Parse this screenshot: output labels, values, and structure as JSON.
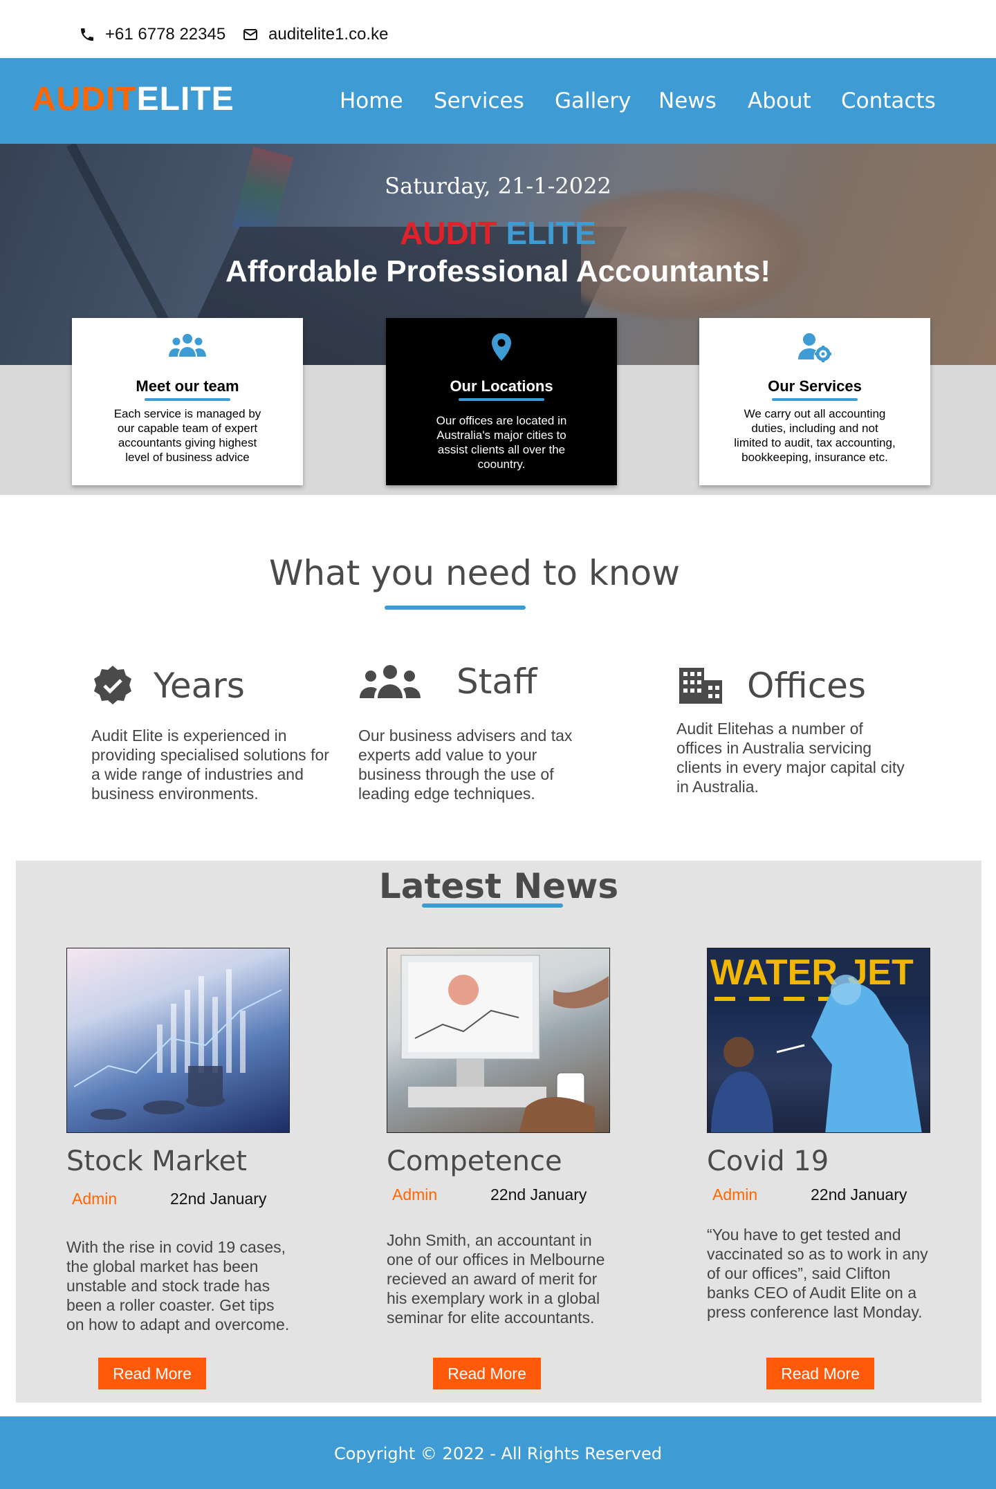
{
  "contact": {
    "phone": "+61 6778 22345",
    "email": "auditelite1.co.ke"
  },
  "brand": {
    "part1": "AUDIT",
    "part2": "ELITE"
  },
  "nav": [
    "Home",
    "Services",
    "Gallery",
    "News",
    "About",
    "Contacts"
  ],
  "hero": {
    "date": "Saturday, 21-1-2022",
    "brand_red": "AUDIT",
    "brand_blue": "ELITE",
    "tagline": "Affordable Professional Accountants!"
  },
  "cards": [
    {
      "title": "Meet our team",
      "text": "Each service is managed by our capable team of expert accountants giving highest level of business advice",
      "icon": "team-icon"
    },
    {
      "title": "Our Locations",
      "text": "Our offices are located in Australia's major cities to assist clients all over the coountry.",
      "icon": "location-pin-icon"
    },
    {
      "title": "Our Services",
      "text": "We carry out all accounting duties, including and not limited to audit, tax accounting, bookkeeping, insurance etc.",
      "icon": "user-gear-icon"
    }
  ],
  "know": {
    "title": "What you need to know",
    "items": [
      {
        "title": "Years",
        "text": "Audit Elite is experienced in providing specialised solutions for a wide range of industries and business environments.",
        "icon": "verified-badge-icon"
      },
      {
        "title": "Staff",
        "text": "Our business advisers and tax experts add value to your business through the use of leading edge techniques.",
        "icon": "people-group-icon"
      },
      {
        "title": "Offices",
        "text": "Audit Elitehas a number of offices in Australia servicing clients in every major capital city in Australia.",
        "icon": "office-building-icon"
      }
    ]
  },
  "news": {
    "title": "Latest News",
    "posts": [
      {
        "title": "Stock Market",
        "author": "Admin",
        "date": "22nd January",
        "text": "With the rise in covid 19 cases, the global market has been unstable and stock trade has been a roller coaster. Get tips on how to adapt and overcome.",
        "button": "Read More"
      },
      {
        "title": "Competence",
        "author": "Admin",
        "date": "22nd January",
        "text": "John Smith, an accountant in one of our offices in Melbourne recieved an award of merit for his exemplary work in a global seminar for elite accountants.",
        "button": "Read More"
      },
      {
        "title": "Covid 19",
        "author": "Admin",
        "date": "22nd January",
        "text": "“You have to get tested and vaccinated so as to work in any of our offices”, said Clifton banks CEO of Audit Elite on a press conference last Monday.",
        "button": "Read More"
      }
    ]
  },
  "footer": {
    "copyright": "Copyright © 2022 - All Rights Reserved"
  },
  "colors": {
    "primary": "#3e9bd3",
    "accent": "#ff6600",
    "brand_red": "#e0232b",
    "band": "#d9d9d9",
    "news_bg": "#e3e3e3"
  }
}
